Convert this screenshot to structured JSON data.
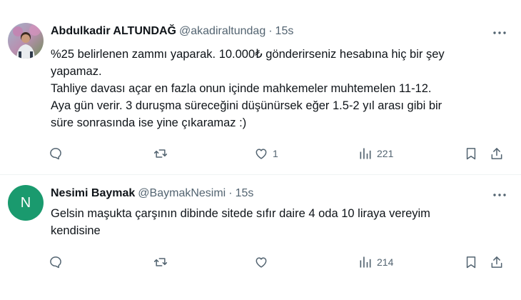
{
  "tweets": [
    {
      "display_name": "Abdulkadir ALTUNDAĞ",
      "handle": "@akadiraltundag",
      "separator": "·",
      "time": "15s",
      "lines": [
        "%25 belirlenen zammı yaparak. 10.000₺ gönderirseniz hesabına hiç bir şey",
        "yapamaz.",
        "Tahliye davası açar en fazla onun içinde mahkemeler muhtemelen 11-12.",
        "Aya gün verir. 3 duruşma süreceğini düşünürsek eğer 1.5-2 yıl arası gibi bir",
        "süre sonrasında ise yine çıkaramaz :)"
      ],
      "replies": "",
      "retweets": "",
      "likes": "1",
      "views": "221"
    },
    {
      "display_name": "Nesimi Baymak",
      "handle": "@BaymakNesimi",
      "separator": "·",
      "time": "15s",
      "avatar_letter": "N",
      "avatar_color": "#1a9a6e",
      "lines": [
        "Gelsin maşukta çarşının dibinde sitede sıfır daire 4 oda 10 liraya vereyim",
        "kendisine"
      ],
      "replies": "",
      "retweets": "",
      "likes": "",
      "views": "214"
    }
  ],
  "colors": {
    "text": "#0f1419",
    "secondary": "#536471",
    "divider": "#eff3f4"
  }
}
